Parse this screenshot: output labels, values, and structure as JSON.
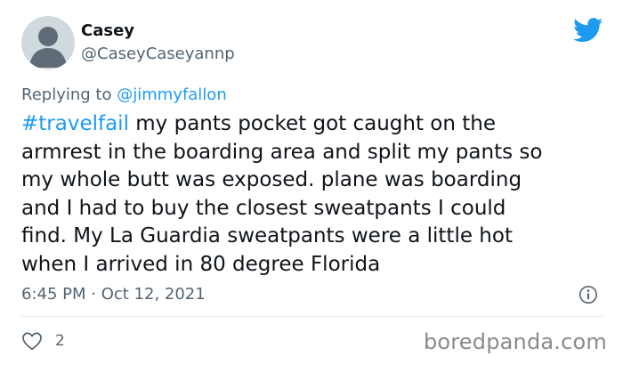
{
  "author": {
    "name": "Casey",
    "handle": "@CaseyCaseyannp"
  },
  "icons": {
    "platform": "twitter-bird-icon",
    "info": "info-icon",
    "like": "heart-icon",
    "avatar": "default-user-avatar"
  },
  "reply": {
    "prefix": "Replying to",
    "mention": "@jimmyfallon"
  },
  "tweet": {
    "hashtag": "#travelfail",
    "line1": " my pants pocket got caught on the",
    "line2": "armrest in the boarding area and split my pants so",
    "line3": "my whole butt was exposed. plane was boarding",
    "line4": "and I had to buy the closest sweatpants I could",
    "line5": "find. My La Guardia sweatpants were a little hot",
    "line6": "when I arrived in 80 degree Florida"
  },
  "meta": {
    "timestamp": "6:45 PM · Oct 12, 2021",
    "likes": "2"
  },
  "watermark": "boredpanda.com",
  "colors": {
    "accent": "#1d9bf0",
    "secondary_text": "#536471",
    "avatar_bg": "#cfd9de"
  }
}
